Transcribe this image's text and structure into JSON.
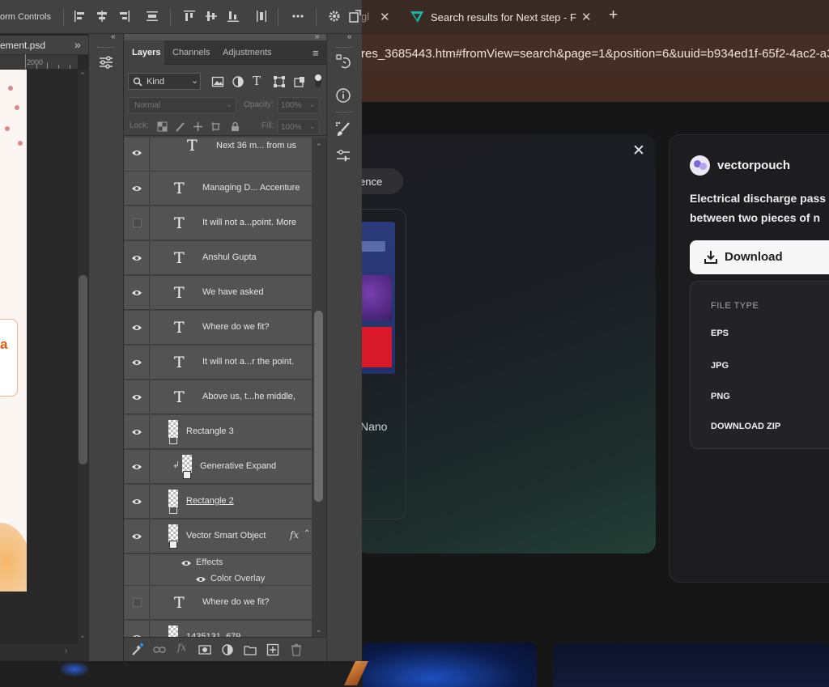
{
  "browser": {
    "tabs": [
      {
        "title": "Google",
        "visible_fragment": "gl"
      },
      {
        "title": "Search results for Next step - Fl",
        "active": true
      }
    ],
    "new_tab_symbol": "+",
    "address_url": "res_3685443.htm#fromView=search&page=1&position=6&uuid=b934ed1f-65f2-4ac2-a3",
    "accent_colors": {
      "tabbar": "#3a2a24",
      "addressbar": "#452e26"
    }
  },
  "asset_page": {
    "chip_label": "ence",
    "thumb_caption": "Nano",
    "author": "vectorpouch",
    "description_lines": [
      "Electrical discharge pass",
      "between two pieces of n"
    ],
    "download_label": "Download",
    "file_type_heading": "FILE TYPE",
    "file_types": [
      "EPS",
      "JPG",
      "PNG",
      "DOWNLOAD ZIP"
    ]
  },
  "photoshop": {
    "options_bar_label": "orm Controls",
    "document_tab": "ement.psd",
    "ruler_label": "2000",
    "layers_panel": {
      "tabs": [
        "Layers",
        "Channels",
        "Adjustments"
      ],
      "active_tab": "Layers",
      "filter_kind": "Kind",
      "blend_mode": "Normal",
      "opacity_label": "Opacity:",
      "opacity_value": "100%",
      "lock_label": "Lock:",
      "fill_label": "Fill:",
      "fill_value": "100%",
      "layers": [
        {
          "name": "Next 36 m... from us",
          "kind": "text",
          "visible": true
        },
        {
          "name": "Managing D... Accenture",
          "kind": "text",
          "visible": true
        },
        {
          "name": "It will not a...point. More",
          "kind": "text",
          "visible": false
        },
        {
          "name": "Anshul Gupta",
          "kind": "text",
          "visible": true
        },
        {
          "name": "We have asked",
          "kind": "text",
          "visible": true
        },
        {
          "name": "Where do we fit?",
          "kind": "text",
          "visible": true
        },
        {
          "name": "It will not a...r the point.",
          "kind": "text",
          "visible": true
        },
        {
          "name": "Above us, t...he middle,",
          "kind": "text",
          "visible": true
        },
        {
          "name": "Rectangle 3",
          "kind": "shape",
          "visible": true
        },
        {
          "name": "Generative Expand",
          "kind": "smart",
          "visible": true,
          "clipped": true
        },
        {
          "name": "Rectangle 2",
          "kind": "shape",
          "visible": true,
          "underlined": true
        },
        {
          "name": "Vector Smart Object",
          "kind": "smart",
          "visible": true,
          "fx": "fx",
          "effects_label": "Effects",
          "effects": [
            "Color Overlay"
          ]
        },
        {
          "name": "Where do we fit?",
          "kind": "text",
          "visible": false
        },
        {
          "name": "1435131_679",
          "kind": "smart",
          "visible": true
        }
      ]
    }
  }
}
